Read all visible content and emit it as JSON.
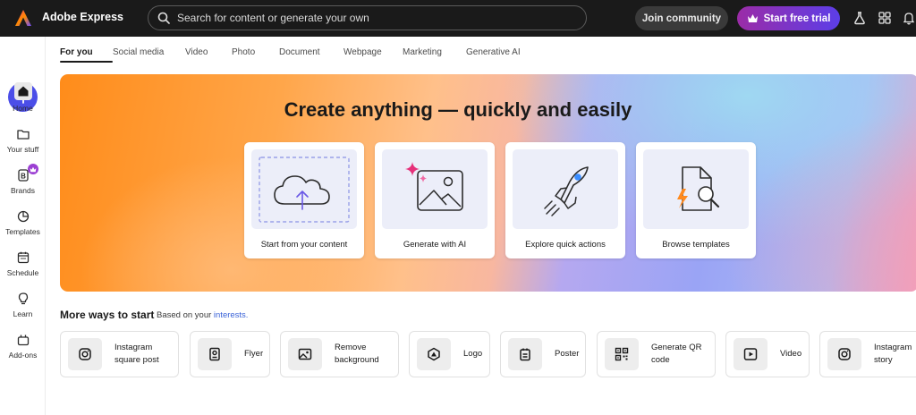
{
  "header": {
    "app_title": "Adobe Express",
    "search_placeholder": "Search for content or generate your own",
    "join_label": "Join community",
    "trial_label": "Start free trial"
  },
  "rail": {
    "items": [
      {
        "label": "Home"
      },
      {
        "label": "Your stuff"
      },
      {
        "label": "Brands"
      },
      {
        "label": "Templates"
      },
      {
        "label": "Schedule"
      },
      {
        "label": "Learn"
      },
      {
        "label": "Add-ons"
      }
    ]
  },
  "tabs": [
    {
      "label": "For you",
      "active": true
    },
    {
      "label": "Social media"
    },
    {
      "label": "Video"
    },
    {
      "label": "Photo"
    },
    {
      "label": "Document"
    },
    {
      "label": "Webpage"
    },
    {
      "label": "Marketing"
    },
    {
      "label": "Generative AI"
    }
  ],
  "hero": {
    "title": "Create anything — quickly and easily",
    "cards": [
      {
        "label": "Start from your content",
        "icon": "cloud-upload-icon"
      },
      {
        "label": "Generate with AI",
        "icon": "image-sparkle-icon"
      },
      {
        "label": "Explore quick actions",
        "icon": "rocket-icon"
      },
      {
        "label": "Browse templates",
        "icon": "template-search-icon"
      }
    ]
  },
  "more_ways": {
    "title": "More ways to start",
    "subtitle_prefix": "Based on your",
    "subtitle_link": "interests.",
    "items": [
      {
        "label_1": "Instagram",
        "label_2": "square post",
        "icon": "instagram-icon"
      },
      {
        "label_1": "Flyer",
        "label_2": "",
        "icon": "flyer-icon"
      },
      {
        "label_1": "Remove",
        "label_2": "background",
        "icon": "remove-background-icon"
      },
      {
        "label_1": "Logo",
        "label_2": "",
        "icon": "logo-icon"
      },
      {
        "label_1": "Poster",
        "label_2": "",
        "icon": "poster-icon"
      },
      {
        "label_1": "Generate QR",
        "label_2": "code",
        "icon": "qr-code-icon"
      },
      {
        "label_1": "Video",
        "label_2": "",
        "icon": "video-icon"
      },
      {
        "label_1": "Instagram",
        "label_2": "story",
        "icon": "instagram-icon"
      }
    ]
  },
  "colors": {
    "topbar": "#1a1a1a",
    "accent_blue": "#4b4ee8",
    "trial_gradient_start": "#9b2ca7",
    "trial_gradient_end": "#5c3ee8",
    "link": "#3b63d8"
  }
}
